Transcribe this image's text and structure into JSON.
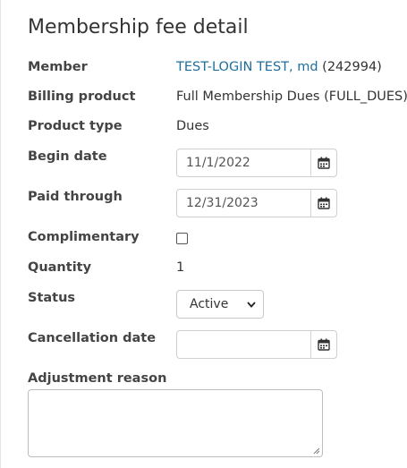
{
  "title": "Membership fee detail",
  "member": {
    "label": "Member",
    "name": "TEST-LOGIN TEST, md",
    "id": "(242994)"
  },
  "billing_product": {
    "label": "Billing product",
    "value": "Full Membership Dues (FULL_DUES)"
  },
  "product_type": {
    "label": "Product type",
    "value": "Dues"
  },
  "begin_date": {
    "label": "Begin date",
    "value": "11/1/2022"
  },
  "paid_through": {
    "label": "Paid through",
    "value": "12/31/2023"
  },
  "complimentary": {
    "label": "Complimentary",
    "checked": false
  },
  "quantity": {
    "label": "Quantity",
    "value": "1"
  },
  "status": {
    "label": "Status",
    "selected": "Active"
  },
  "cancellation_date": {
    "label": "Cancellation date",
    "value": ""
  },
  "adjustment_reason": {
    "label": "Adjustment reason",
    "value": ""
  },
  "icons": {
    "calendar": "calendar-icon",
    "chevron": "chevron-down-icon",
    "grip": "resize-grip-icon"
  }
}
